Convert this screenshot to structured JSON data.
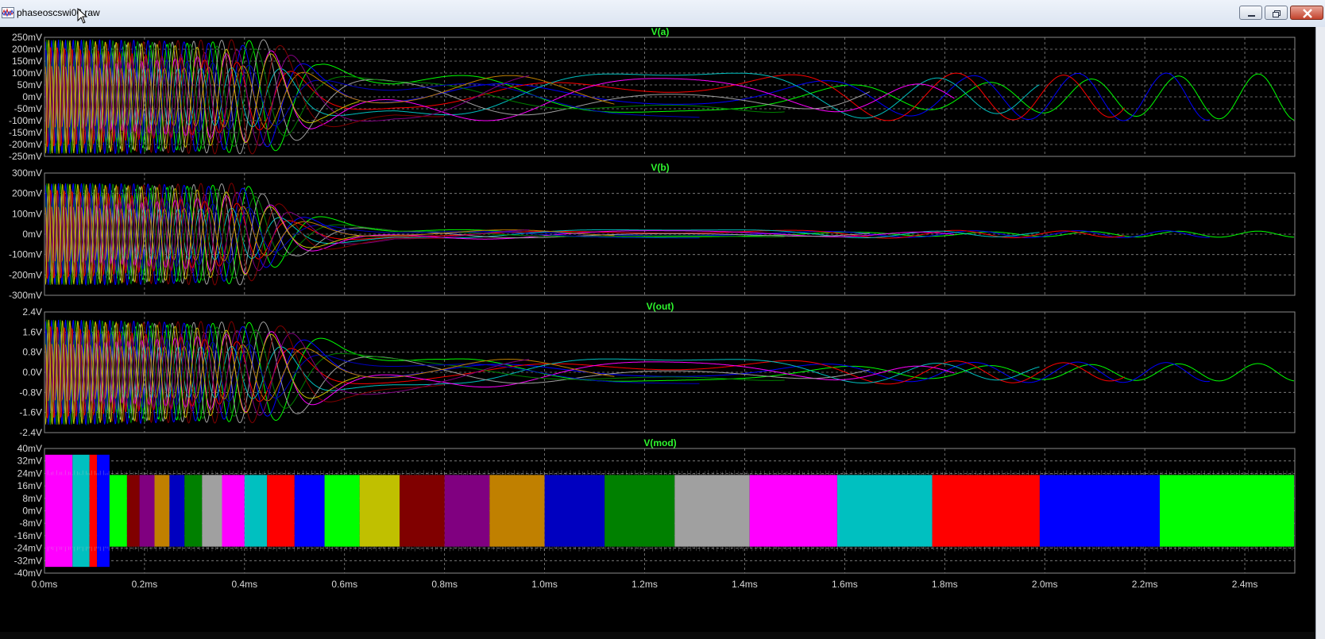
{
  "window": {
    "title": "phaseoscswi06.raw"
  },
  "colors": {
    "background": "#000000",
    "frame": "#8a8a8a",
    "grid": "#8a8a8a",
    "tick_text": "#d8d8d8",
    "panel_title": "#2ef52e"
  },
  "chart_data": [
    {
      "type": "line",
      "title": "V(a)",
      "x_unit": "ms",
      "y_unit": "mV",
      "xlim": [
        0,
        2.5
      ],
      "ylim": [
        -250,
        250
      ],
      "y_ticks": [
        "250mV",
        "200mV",
        "150mV",
        "100mV",
        "50mV",
        "0mV",
        "-50mV",
        "-100mV",
        "-150mV",
        "-200mV",
        "-250mV"
      ],
      "grid": true,
      "series_colors": [
        "#00ff00",
        "#0000ff",
        "#ff0000",
        "#00c0c0",
        "#ff00ff",
        "#a0a0a0",
        "#008000",
        "#0000c0",
        "#c08000",
        "#800080",
        "#800000",
        "#c0c000"
      ],
      "envelope": [
        {
          "x": 0.0,
          "amp": 240
        },
        {
          "x": 0.45,
          "amp": 240
        },
        {
          "x": 0.55,
          "amp": 140
        },
        {
          "x": 0.7,
          "amp": 100
        },
        {
          "x": 2.5,
          "amp": 100
        }
      ]
    },
    {
      "type": "line",
      "title": "V(b)",
      "x_unit": "ms",
      "y_unit": "mV",
      "xlim": [
        0,
        2.5
      ],
      "ylim": [
        -300,
        300
      ],
      "y_ticks": [
        "300mV",
        "200mV",
        "100mV",
        "0mV",
        "-100mV",
        "-200mV",
        "-300mV"
      ],
      "grid": true,
      "series_colors": [
        "#00ff00",
        "#0000ff",
        "#ff0000",
        "#00c0c0",
        "#ff00ff",
        "#a0a0a0",
        "#008000",
        "#0000c0",
        "#c08000",
        "#800080",
        "#800000",
        "#c0c000"
      ],
      "envelope": [
        {
          "x": 0.0,
          "amp": 250
        },
        {
          "x": 0.4,
          "amp": 250
        },
        {
          "x": 0.5,
          "amp": 110
        },
        {
          "x": 0.7,
          "amp": 25
        },
        {
          "x": 2.5,
          "amp": 15
        }
      ]
    },
    {
      "type": "line",
      "title": "V(out)",
      "x_unit": "ms",
      "y_unit": "V",
      "xlim": [
        0,
        2.5
      ],
      "ylim": [
        -2.4,
        2.4
      ],
      "y_ticks": [
        "2.4V",
        "1.6V",
        "0.8V",
        "0.0V",
        "-0.8V",
        "-1.6V",
        "-2.4V"
      ],
      "grid": true,
      "series_colors": [
        "#00ff00",
        "#0000ff",
        "#ff0000",
        "#00c0c0",
        "#ff00ff",
        "#a0a0a0",
        "#008000",
        "#0000c0",
        "#c08000",
        "#800080",
        "#800000",
        "#c0c000"
      ],
      "envelope": [
        {
          "x": 0.0,
          "amp": 2.1
        },
        {
          "x": 0.45,
          "amp": 2.0
        },
        {
          "x": 0.6,
          "amp": 1.1
        },
        {
          "x": 0.8,
          "amp": 0.6
        },
        {
          "x": 2.5,
          "amp": 0.35
        }
      ]
    },
    {
      "type": "area",
      "title": "V(mod)",
      "x_unit": "ms",
      "y_unit": "mV",
      "xlim": [
        0,
        2.5
      ],
      "ylim": [
        -40,
        40
      ],
      "y_ticks": [
        "40mV",
        "32mV",
        "24mV",
        "16mV",
        "8mV",
        "0mV",
        "-8mV",
        "-16mV",
        "-24mV",
        "-32mV",
        "-40mV"
      ],
      "grid": true,
      "band_amplitude": 23,
      "bands": [
        {
          "x0": 0.0,
          "x1": 0.056,
          "color": "#ff00ff"
        },
        {
          "x0": 0.056,
          "x1": 0.09,
          "color": "#00c0c0"
        },
        {
          "x0": 0.09,
          "x1": 0.105,
          "color": "#ff0000"
        },
        {
          "x0": 0.105,
          "x1": 0.13,
          "color": "#0000ff"
        },
        {
          "x0": 0.13,
          "x1": 0.165,
          "color": "#00ff00"
        },
        {
          "x0": 0.165,
          "x1": 0.19,
          "color": "#800000"
        },
        {
          "x0": 0.19,
          "x1": 0.22,
          "color": "#800080"
        },
        {
          "x0": 0.22,
          "x1": 0.25,
          "color": "#c08000"
        },
        {
          "x0": 0.25,
          "x1": 0.28,
          "color": "#0000c0"
        },
        {
          "x0": 0.28,
          "x1": 0.315,
          "color": "#008000"
        },
        {
          "x0": 0.315,
          "x1": 0.355,
          "color": "#a0a0a0"
        },
        {
          "x0": 0.355,
          "x1": 0.4,
          "color": "#ff00ff"
        },
        {
          "x0": 0.4,
          "x1": 0.445,
          "color": "#00c0c0"
        },
        {
          "x0": 0.445,
          "x1": 0.5,
          "color": "#ff0000"
        },
        {
          "x0": 0.5,
          "x1": 0.56,
          "color": "#0000ff"
        },
        {
          "x0": 0.56,
          "x1": 0.63,
          "color": "#00ff00"
        },
        {
          "x0": 0.63,
          "x1": 0.71,
          "color": "#c0c000"
        },
        {
          "x0": 0.71,
          "x1": 0.8,
          "color": "#800000"
        },
        {
          "x0": 0.8,
          "x1": 0.89,
          "color": "#800080"
        },
        {
          "x0": 0.89,
          "x1": 1.0,
          "color": "#c08000"
        },
        {
          "x0": 1.0,
          "x1": 1.12,
          "color": "#0000c0"
        },
        {
          "x0": 1.12,
          "x1": 1.26,
          "color": "#008000"
        },
        {
          "x0": 1.26,
          "x1": 1.41,
          "color": "#a0a0a0"
        },
        {
          "x0": 1.41,
          "x1": 1.585,
          "color": "#ff00ff"
        },
        {
          "x0": 1.585,
          "x1": 1.775,
          "color": "#00c0c0"
        },
        {
          "x0": 1.775,
          "x1": 1.99,
          "color": "#ff0000"
        },
        {
          "x0": 1.99,
          "x1": 2.23,
          "color": "#0000ff"
        },
        {
          "x0": 2.23,
          "x1": 2.5,
          "color": "#00ff00"
        }
      ]
    }
  ],
  "x_ticks": [
    "0.0ms",
    "0.2ms",
    "0.4ms",
    "0.6ms",
    "0.8ms",
    "1.0ms",
    "1.2ms",
    "1.4ms",
    "1.6ms",
    "1.8ms",
    "2.0ms",
    "2.2ms",
    "2.4ms"
  ],
  "x_tick_values": [
    0.0,
    0.2,
    0.4,
    0.6,
    0.8,
    1.0,
    1.2,
    1.4,
    1.6,
    1.8,
    2.0,
    2.2,
    2.4
  ]
}
